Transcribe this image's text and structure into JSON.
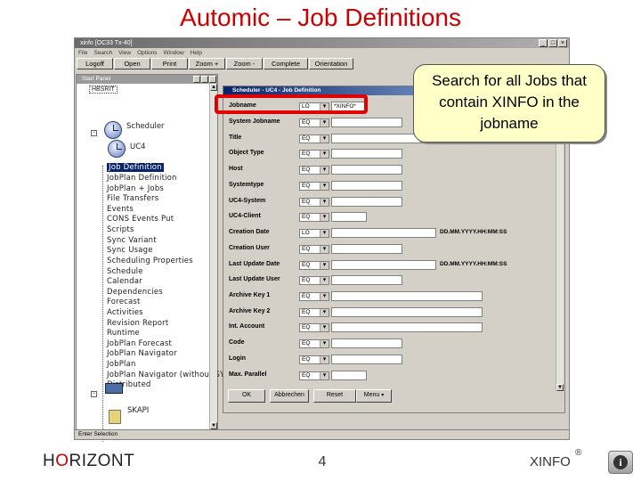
{
  "slide": {
    "title": "Automic – Job Definitions",
    "callout": "Search for all Jobs that contain XINFO in the jobname",
    "logo_prefix": "H",
    "logo_o": "O",
    "logo_suffix": "RIZONT",
    "page_number": "4",
    "brand": "XINFO",
    "registered": "®",
    "info_icon": "i"
  },
  "window": {
    "title": "xinfo [OC33 Tx-40]",
    "menu": [
      "File",
      "Search",
      "View",
      "Options",
      "Window",
      "Help"
    ],
    "toolbar": [
      "Logoff",
      "Open",
      "Print",
      "Zoom +",
      "Zoom -",
      "Complete",
      "Orientation"
    ],
    "status": "Enter Selection"
  },
  "explorer": {
    "title": "Start Panel",
    "root": "HBSRIT",
    "scheduler_label": "Scheduler",
    "uc4_label": "UC4",
    "bottom_label": "SKAPI",
    "items": [
      "Job Definition",
      "JobPlan Definition",
      "JobPlan + Jobs",
      "File Transfers",
      "Events",
      "CONS Events Put",
      "Scripts",
      "Sync Variant",
      "Sync Usage",
      "Scheduling Properties",
      "Schedule",
      "Calendar",
      "Dependencies",
      "Forecast",
      "Activities",
      "Revision Report",
      "Runtime",
      "JobPlan Forecast",
      "JobPlan Navigator",
      "JobPlan",
      "JobPlan Navigator (without SYNC)",
      "Distributed"
    ]
  },
  "dialog": {
    "title": "Scheduler - UC4 - Job Definition",
    "fields": [
      {
        "label": "Jobname",
        "op": "LO",
        "value": "*XINFO*"
      },
      {
        "label": "System Jobname",
        "op": "EQ",
        "value": ""
      },
      {
        "label": "Title",
        "op": "EQ",
        "value": ""
      },
      {
        "label": "Object Type",
        "op": "EQ",
        "value": ""
      },
      {
        "label": "Host",
        "op": "EQ",
        "value": ""
      },
      {
        "label": "Systemtype",
        "op": "EQ",
        "value": ""
      },
      {
        "label": "UC4-System",
        "op": "EQ",
        "value": ""
      },
      {
        "label": "UC4-Client",
        "op": "EQ",
        "value": ""
      },
      {
        "label": "Creation Date",
        "op": "LO",
        "value": "",
        "hint": "DD.MM.YYYY.HH:MM:SS"
      },
      {
        "label": "Creation User",
        "op": "EQ",
        "value": ""
      },
      {
        "label": "Last Update Date",
        "op": "EQ",
        "value": "",
        "hint": "DD.MM.YYYY.HH:MM:SS"
      },
      {
        "label": "Last Update User",
        "op": "EQ",
        "value": ""
      },
      {
        "label": "Archive Key 1",
        "op": "EQ",
        "value": ""
      },
      {
        "label": "Archive Key 2",
        "op": "EQ",
        "value": ""
      },
      {
        "label": "Int. Account",
        "op": "EQ",
        "value": ""
      },
      {
        "label": "Code",
        "op": "EQ",
        "value": ""
      },
      {
        "label": "Login",
        "op": "EQ",
        "value": ""
      },
      {
        "label": "Max. Parallel",
        "op": "EQ",
        "value": ""
      }
    ],
    "buttons": {
      "ok": "OK",
      "cancel": "Abbrechen",
      "reset": "Reset",
      "menu": "Menu"
    }
  },
  "colors": {
    "title": "#cc0000",
    "highlight": "#e00000",
    "callout_bg": "#ffffc8",
    "selection": "#0a246a"
  }
}
